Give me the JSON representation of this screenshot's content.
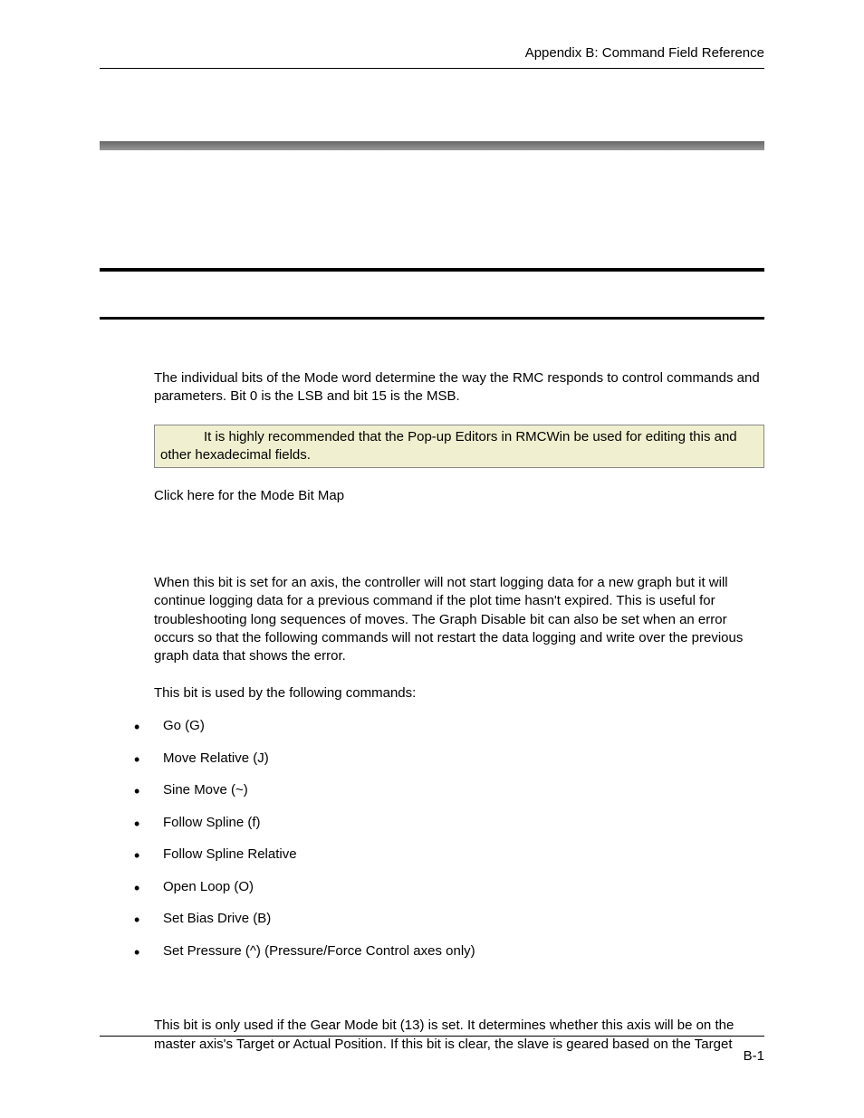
{
  "header": {
    "right": "Appendix B:  Command Field Reference"
  },
  "paras": {
    "intro": "The individual bits of the Mode word determine the way the RMC responds to control commands and parameters. Bit 0 is the LSB and bit 15 is the MSB.",
    "note": "It is highly recommended that the Pop-up Editors in RMCWin be used for editing this and other hexadecimal fields.",
    "link": "Click here for the Mode Bit Map",
    "bit0_desc": "When this bit is set for an axis, the controller will not start logging data for a new graph but it will continue logging data for a previous command if the plot time hasn't expired. This is useful for troubleshooting long sequences of moves. The Graph Disable bit can also be set when an error occurs so that the following commands will not restart the data logging and write over the previous graph data that shows the error.",
    "bit0_used_by": "This bit is used by the following commands:",
    "bit1_desc": "This bit is only used if the Gear Mode bit (13) is set. It determines whether this axis will be on the master axis's Target or Actual Position. If this bit is clear, the slave is geared based on the Target"
  },
  "commands": [
    "Go (G)",
    "Move Relative (J)",
    "Sine Move (~)",
    "Follow Spline (f)",
    "Follow Spline Relative",
    "Open Loop (O)",
    "Set Bias Drive (B)",
    "Set Pressure (^) (Pressure/Force Control axes only)"
  ],
  "footer": {
    "page": "B-1"
  }
}
